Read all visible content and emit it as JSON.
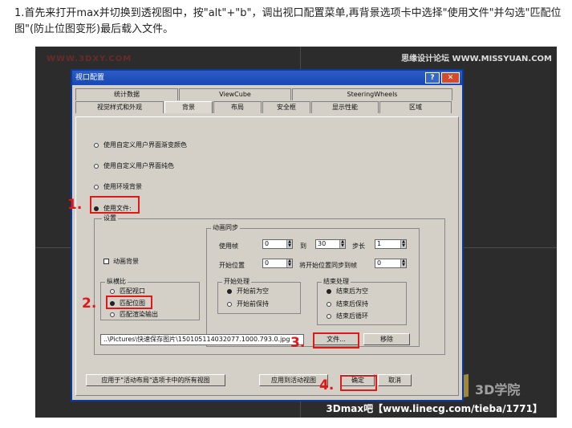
{
  "instruction": "1.首先来打开max并切换到透视图中，按\"alt\"+\"b\"，调出视口配置菜单,再背景选项卡中选择\"使用文件\"并勾选\"匹配位图\"(防止位图变形)最后载入文件。",
  "watermarks": {
    "top_left": "WWW.3DXY.COM",
    "top_right": "思缘设计论坛 WWW.MISSYUAN.COM",
    "logo": "3D学院",
    "bottom": "3Dmax吧【www.linecg.com/tieba/1771】"
  },
  "dialog": {
    "title": "视口配置",
    "help_label": "?",
    "close_label": "✕",
    "tabs_row1": [
      "统计数据",
      "ViewCube",
      "SteeringWheels"
    ],
    "tabs_row2": [
      "视觉样式和外观",
      "背景",
      "布局",
      "安全框",
      "显示性能",
      "区域"
    ],
    "active_tab": "背景"
  },
  "background": {
    "option1": "使用自定义用户界面渐变颜色",
    "option2": "使用自定义用户界面纯色",
    "option3": "使用环境背景",
    "option4": "使用文件:",
    "settings_label": "设置",
    "animate_bg": "动画背景",
    "aspect_group": "纵横比",
    "aspect_opts": [
      "匹配视口",
      "匹配位图",
      "匹配渲染输出"
    ],
    "anim_sync": "动画同步",
    "use_frame": "使用帧",
    "use_frame_val": "0",
    "to": "到",
    "to_val": "30",
    "step": "步长",
    "step_val": "1",
    "start_pos": "开始位置",
    "start_pos_val": "0",
    "sync_start": "将开始位置同步到帧",
    "sync_start_val": "0",
    "start_proc": "开始处理",
    "start_opts": [
      "开始前为空",
      "开始前保持"
    ],
    "end_proc": "结束处理",
    "end_opts": [
      "结束后为空",
      "结束后保持",
      "结束后循环"
    ],
    "file_path": "..\\Pictures\\快速保存图片\\150105114032077.1000.793.0.jpg",
    "file_btn": "文件...",
    "remove_btn": "移除"
  },
  "footer": {
    "apply_all": "应用于\"活动布局\"选项卡中的所有视图",
    "apply_active": "应用到活动视图",
    "ok": "确定",
    "cancel": "取消"
  },
  "steps": [
    "1.",
    "2.",
    "3.",
    "4."
  ],
  "colors": {
    "highlight": "#e01818",
    "titlebar": "#1848b4",
    "dialog_bg": "#d4d0c8"
  }
}
